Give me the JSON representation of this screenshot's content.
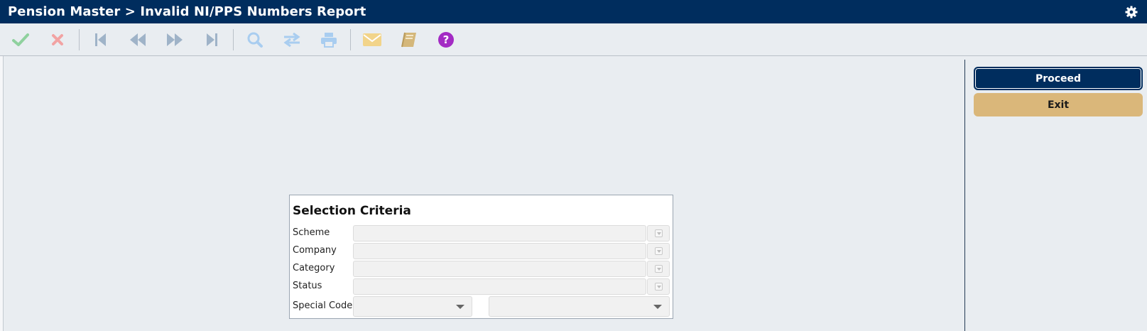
{
  "window": {
    "title": "Pension Master > Invalid NI/PPS Numbers Report"
  },
  "toolbar": {
    "items": [
      {
        "name": "confirm-icon",
        "color": "#8fd19e"
      },
      {
        "name": "cancel-icon",
        "color": "#f2a3a3"
      },
      {
        "name": "first-record-icon",
        "color": "#9fb3c8"
      },
      {
        "name": "previous-record-icon",
        "color": "#9fb3c8"
      },
      {
        "name": "next-record-icon",
        "color": "#9fb3c8"
      },
      {
        "name": "last-record-icon",
        "color": "#9fb3c8"
      },
      {
        "name": "search-icon",
        "color": "#a9cdf0"
      },
      {
        "name": "swap-icon",
        "color": "#a9cdf0"
      },
      {
        "name": "print-icon",
        "color": "#a9cdf0"
      },
      {
        "name": "mail-icon",
        "color": "#f2d48a"
      },
      {
        "name": "notebook-icon",
        "color": "#d4b77a"
      },
      {
        "name": "help-icon",
        "color": "#a32bc4"
      }
    ]
  },
  "actions": {
    "proceed_label": "Proceed",
    "exit_label": "Exit"
  },
  "selection": {
    "title": "Selection Criteria",
    "scheme_label": "Scheme",
    "scheme_value": "",
    "company_label": "Company",
    "company_value": "",
    "category_label": "Category",
    "category_value": "",
    "status_label": "Status",
    "status_value": "",
    "special_code_label": "Special Code",
    "special_code_1_value": "",
    "special_code_2_value": ""
  },
  "colors": {
    "header_bg": "#002d5e",
    "page_bg": "#e9edf1",
    "exit_button_bg": "#dab77a"
  }
}
